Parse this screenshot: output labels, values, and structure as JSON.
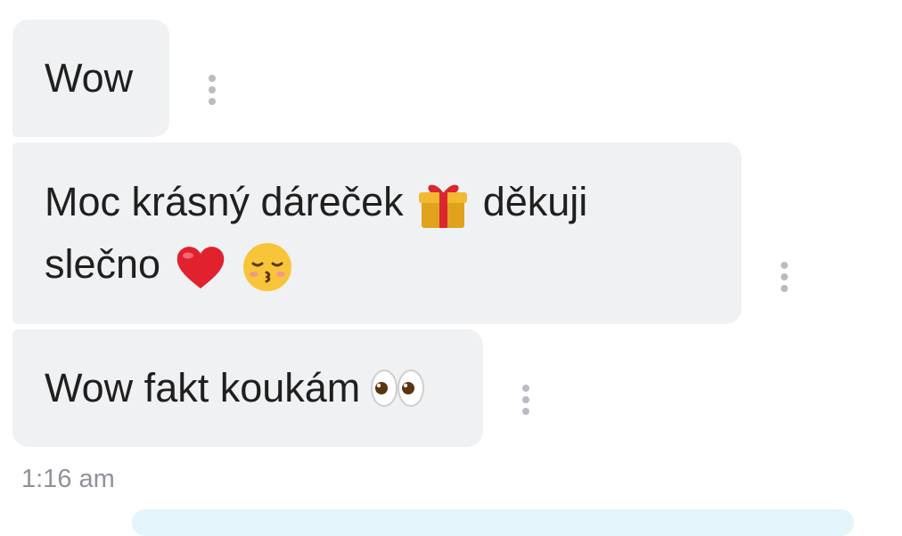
{
  "messages": [
    {
      "text": "Wow"
    },
    {
      "line1": "Moc krásný dáreček",
      "line1_after": "děkuji",
      "line2": "slečno"
    },
    {
      "text": "Wow fakt koukám"
    }
  ],
  "icons": {
    "gift": "gift-emoji",
    "heart": "red-heart-emoji",
    "kiss": "kissing-face-emoji",
    "eyes": "eyes-emoji",
    "more": "more-vertical-icon"
  },
  "timestamp": "1:16 am",
  "colors": {
    "bubble_bg": "#f0f1f3",
    "text": "#1f1f1f",
    "timestamp": "#8f9399",
    "next_bubble": "#e3f4fb"
  }
}
